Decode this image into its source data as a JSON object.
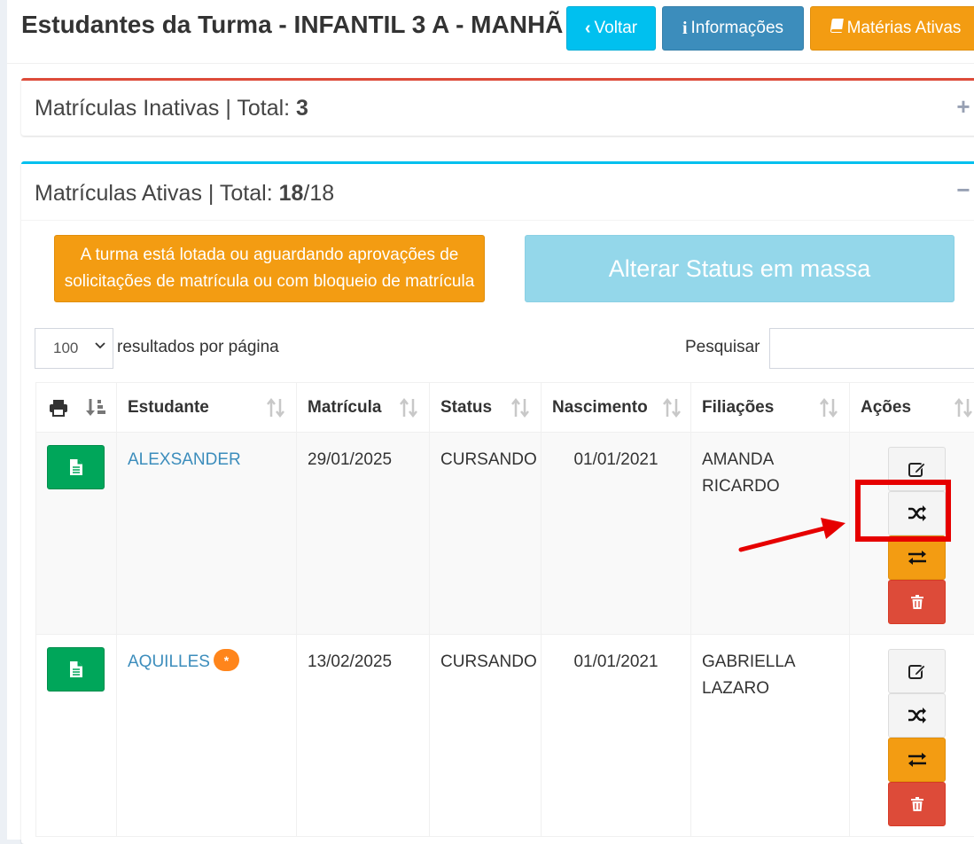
{
  "header": {
    "title": "Estudantes da Turma - INFANTIL 3 A - MANHÃ",
    "voltar_label": "Voltar",
    "info_label": "Informações",
    "materias_label": "Matérias Ativas"
  },
  "inactive": {
    "label": "Matrículas Inativas | Total: ",
    "total": "3",
    "toggle": "+"
  },
  "active": {
    "label": "Matrículas Ativas | Total: ",
    "count": "18",
    "of": "/18",
    "toggle": "−"
  },
  "notice": {
    "line1": "A turma está lotada ou aguardando aprovações de",
    "line2": "solicitações de matrícula ou com bloqueio de matrícula"
  },
  "mass_status_label": "Alterar Status em massa",
  "table_controls": {
    "page_length": "100",
    "page_length_label": "resultados por página",
    "search_label": "Pesquisar",
    "search_value": ""
  },
  "columns": {
    "estudante": "Estudante",
    "matricula": "Matrícula",
    "status": "Status",
    "nascimento": "Nascimento",
    "filiacoes": "Filiações",
    "acoes": "Ações"
  },
  "rows": [
    {
      "estudante": "ALEXSANDER",
      "matricula": "29/01/2025",
      "status": "CURSANDO",
      "nascimento": "01/01/2021",
      "filiacao1": "AMANDA",
      "filiacao2": "RICARDO"
    },
    {
      "estudante": "AQUILLES",
      "badge": "*",
      "matricula": "13/02/2025",
      "status": "CURSANDO",
      "nascimento": "01/01/2021",
      "filiacao1": "GABRIELLA",
      "filiacao2": "LAZARO"
    }
  ],
  "colors": {
    "info": "#00c0ef",
    "primary": "#3c8dbc",
    "warning": "#f39c12",
    "success": "#00a65a",
    "danger": "#dd4b39",
    "annotation": "#e60000"
  }
}
